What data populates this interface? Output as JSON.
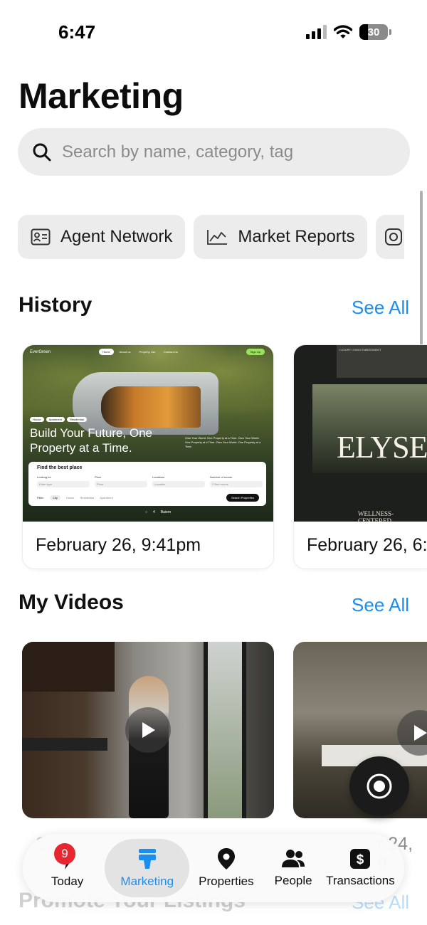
{
  "status": {
    "time": "6:47",
    "battery": "30",
    "battery_level": 0.3
  },
  "page": {
    "title": "Marketing"
  },
  "search": {
    "placeholder": "Search by name, category, tag"
  },
  "chips": [
    {
      "label": "Agent Network",
      "icon": "contact-card-icon"
    },
    {
      "label": "Market Reports",
      "icon": "line-chart-icon"
    },
    {
      "label": "",
      "icon": "instagram-icon"
    }
  ],
  "history": {
    "title": "History",
    "see_all": "See All",
    "items": [
      {
        "date": "February 26, 9:41pm",
        "preview": {
          "brand": "EverGreen",
          "nav": [
            "Home",
            "About us",
            "Property List",
            "Contact Us"
          ],
          "cta": "Sign Up",
          "tags": [
            "House",
            "Apartment",
            "Residential"
          ],
          "headline": "Build Your Future, One Property at a Time.",
          "blurb": "Own Your World. One Property at a Time. Own Your World. One Property at a Time. Own Your World. One Property at a Time.",
          "form_title": "Find the best place",
          "fields": [
            {
              "label": "Looking for",
              "placeholder": "Enter type"
            },
            {
              "label": "Price",
              "placeholder": "Price"
            },
            {
              "label": "Locations",
              "placeholder": "Location"
            },
            {
              "label": "Number of rooms",
              "placeholder": "2 Bed rooms"
            }
          ],
          "filter_label": "Filter:",
          "filters": [
            "City",
            "House",
            "Residential",
            "Apartment"
          ],
          "search_button": "Search Properties",
          "footer_count": "4",
          "footer_dropdown": "Baiem"
        }
      },
      {
        "date": "February 26, 6:",
        "preview": {
          "headline": "ELYSE",
          "subhead": "WELLNESS-CENTERED",
          "caption": "LUXURY LIVING EMBODIMENT"
        }
      }
    ]
  },
  "videos": {
    "title": "My Videos",
    "see_all": "See All",
    "items": [
      {
        "caption": "S"
      },
      {
        "caption": "r 24, 9"
      }
    ]
  },
  "promote": {
    "title": "Promote Your Listings",
    "see_all": "See All"
  },
  "tabbar": {
    "items": [
      {
        "label": "Today",
        "icon": "lightning-icon",
        "badge": "9"
      },
      {
        "label": "Marketing",
        "icon": "megaphone-icon",
        "active": true
      },
      {
        "label": "Properties",
        "icon": "map-pin-icon"
      },
      {
        "label": "People",
        "icon": "people-icon"
      },
      {
        "label": "Transactions",
        "icon": "dollar-icon"
      }
    ]
  },
  "colors": {
    "accent": "#1a8ff0",
    "badge": "#e8262f",
    "chip_bg": "#ececec"
  }
}
